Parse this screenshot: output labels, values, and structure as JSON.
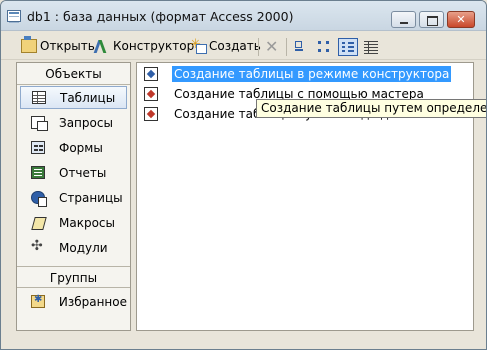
{
  "window": {
    "title": "db1 : база данных (формат Access 2000)"
  },
  "toolbar": {
    "open_label": "Открыть",
    "design_label": "Конструктор",
    "new_label": "Создать",
    "icons": [
      "delete-icon",
      "large-icons-view-icon",
      "small-icons-view-icon",
      "list-view-icon",
      "details-view-icon"
    ],
    "active_view": "list"
  },
  "sidebar": {
    "objects_header": "Объекты",
    "items": [
      {
        "label": "Таблицы",
        "icon": "table-icon",
        "selected": true
      },
      {
        "label": "Запросы",
        "icon": "query-icon",
        "selected": false
      },
      {
        "label": "Формы",
        "icon": "form-icon",
        "selected": false
      },
      {
        "label": "Отчеты",
        "icon": "report-icon",
        "selected": false
      },
      {
        "label": "Страницы",
        "icon": "page-icon",
        "selected": false
      },
      {
        "label": "Макросы",
        "icon": "macro-icon",
        "selected": false
      },
      {
        "label": "Модули",
        "icon": "module-icon",
        "selected": false
      }
    ],
    "groups_header": "Группы",
    "groups": [
      {
        "label": "Избранное",
        "icon": "favorites-icon"
      }
    ]
  },
  "list": {
    "items": [
      {
        "label": "Создание таблицы в режиме конструктора",
        "icon": "design-table-icon",
        "selected": true
      },
      {
        "label": "Создание таблицы с помощью мастера",
        "icon": "wizard-icon",
        "selected": false
      },
      {
        "label": "Создание таблицы путем ввода данных",
        "icon": "entry-icon",
        "selected": false
      }
    ]
  },
  "tooltip": {
    "text": "Создание таблицы путем определения имен"
  },
  "colors": {
    "selection": "#3399ff",
    "tooltip_bg": "#ffffe1",
    "window_bg": "#e9e5da"
  }
}
